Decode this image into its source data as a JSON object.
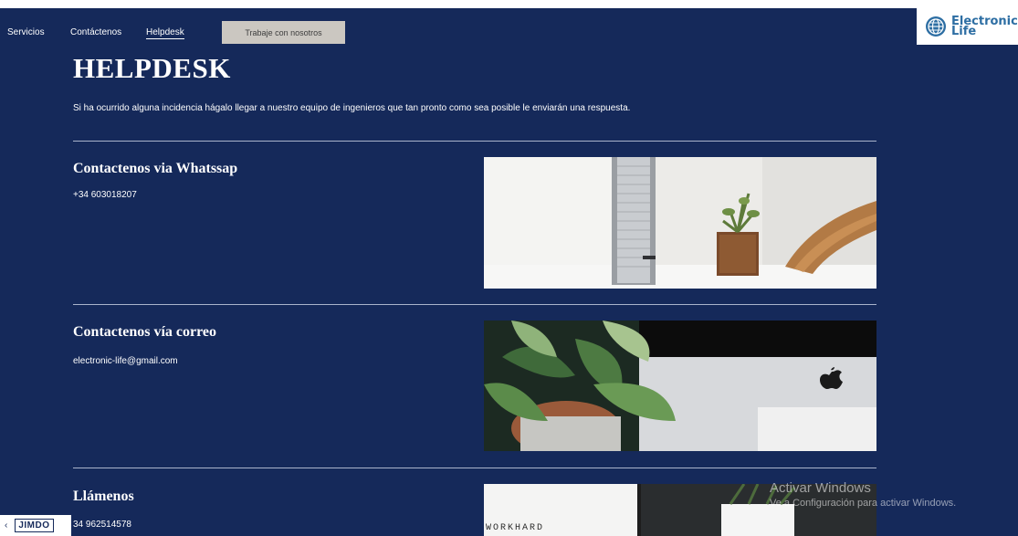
{
  "nav": {
    "items": [
      {
        "label": "Servicios"
      },
      {
        "label": "Contáctenos"
      },
      {
        "label": "Helpdesk"
      }
    ],
    "cta_label": "Trabaje con nosotros"
  },
  "logo": {
    "line1": "Electronic",
    "line2": "Life"
  },
  "page": {
    "title": "HELPDESK",
    "intro": "Si ha ocurrido alguna incidencia hágalo llegar a nuestro equipo de ingenieros que tan pronto como sea posible le enviarán una respuesta."
  },
  "sections": [
    {
      "title": "Contactenos via Whatssap",
      "text": "+34 603018207"
    },
    {
      "title": "Contactenos vía correo",
      "text": "electronic-life@gmail.com"
    },
    {
      "title": "Llámenos",
      "text": "34 962514578"
    }
  ],
  "images": {
    "workhard_text": "WORKHARD"
  },
  "windows_notice": {
    "line1": "Activar Windows",
    "line2": "Ve a Configuración para activar Windows."
  },
  "jimdo": {
    "label": "JIMDO"
  }
}
